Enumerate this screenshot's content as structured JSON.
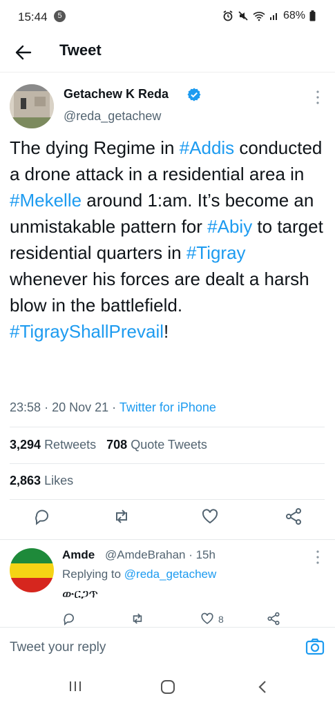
{
  "status": {
    "time": "15:44",
    "badge": "5",
    "battery": "68%"
  },
  "header": {
    "title": "Tweet"
  },
  "tweet": {
    "author_name": "Getachew K Reda",
    "author_handle": "@reda_getachew",
    "text_parts": [
      {
        "t": "The dying Regime in ",
        "h": false
      },
      {
        "t": "#Addis",
        "h": true
      },
      {
        "t": " conducted a drone attack in a residential area in ",
        "h": false
      },
      {
        "t": "#Mekelle",
        "h": true
      },
      {
        "t": " around 1:am. It’s become an unmistakable pattern for ",
        "h": false
      },
      {
        "t": "#Abiy",
        "h": true
      },
      {
        "t": " to target residential quarters in ",
        "h": false
      },
      {
        "t": "#Tigray",
        "h": true
      },
      {
        "t": " whenever his forces are dealt a harsh blow in the battlefield. ",
        "h": false
      },
      {
        "t": "#TigrayShallPrevail",
        "h": true
      },
      {
        "t": "!",
        "h": false
      }
    ],
    "time": "23:58",
    "date": "20 Nov 21",
    "source": "Twitter for iPhone",
    "retweets": "3,294",
    "retweets_label": "Retweets",
    "quotes": "708",
    "quotes_label": "Quote Tweets",
    "likes": "2,863",
    "likes_label": "Likes"
  },
  "reply": {
    "author_name": "Amde",
    "author_handle": "@AmdeBrahan · 15h",
    "replying_prefix": "Replying to ",
    "replying_to": "@reda_getachew",
    "text": "ውርጋጥ",
    "like_count": "8"
  },
  "composer": {
    "placeholder": "Tweet your reply"
  },
  "colors": {
    "accent": "#1d9bf0",
    "muted": "#536471"
  }
}
